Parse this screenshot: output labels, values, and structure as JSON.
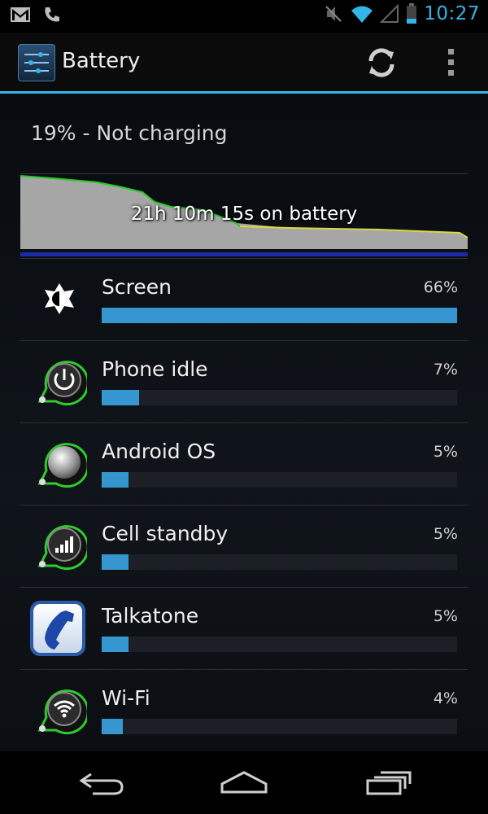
{
  "status_bar": {
    "time": "10:27",
    "icons": [
      "gmail-icon",
      "phone-icon",
      "mute-icon",
      "wifi-icon",
      "signal-icon",
      "battery-icon"
    ]
  },
  "action_bar": {
    "title": "Battery",
    "icons": [
      "settings-app-icon",
      "refresh-icon",
      "overflow-menu-icon"
    ]
  },
  "summary": {
    "text": "19% - Not charging"
  },
  "graph": {
    "label": "21h 10m 15s on battery"
  },
  "items": [
    {
      "name": "Screen",
      "percent": "66%",
      "value": 66,
      "icon": "brightness-icon"
    },
    {
      "name": "Phone idle",
      "percent": "7%",
      "value": 7,
      "icon": "power-icon"
    },
    {
      "name": "Android OS",
      "percent": "5%",
      "value": 5,
      "icon": "android-os-icon"
    },
    {
      "name": "Cell standby",
      "percent": "5%",
      "value": 5,
      "icon": "cell-signal-icon"
    },
    {
      "name": "Talkatone",
      "percent": "5%",
      "value": 5,
      "icon": "talkatone-icon"
    },
    {
      "name": "Wi-Fi",
      "percent": "4%",
      "value": 4,
      "icon": "wifi-icon"
    }
  ],
  "colors": {
    "accent": "#33b5e5",
    "bar": "#3596d0",
    "graph_green": "#22cc22",
    "graph_yellow": "#d8d840"
  },
  "nav": [
    "back-icon",
    "home-icon",
    "recent-apps-icon"
  ]
}
